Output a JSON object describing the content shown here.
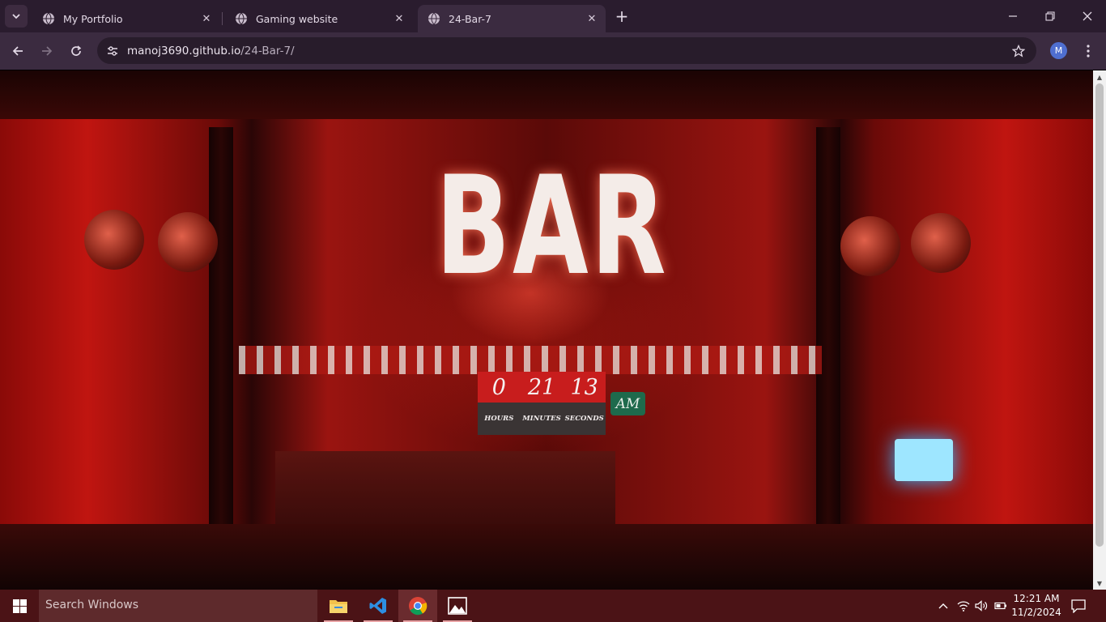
{
  "browser": {
    "tabs": [
      {
        "title": "My Portfolio",
        "active": false
      },
      {
        "title": "Gaming website",
        "active": false
      },
      {
        "title": "24-Bar-7",
        "active": true
      }
    ],
    "url_host": "manoj3690.github.io",
    "url_path": "/24-Bar-7/",
    "profile_initial": "M"
  },
  "page": {
    "sign_text": [
      "B",
      "A",
      "R"
    ],
    "clock": {
      "hours": "0",
      "minutes": "21",
      "seconds": "13",
      "hours_label": "HOURS",
      "minutes_label": "MINUTES",
      "seconds_label": "SECONDS",
      "period": "AM"
    }
  },
  "taskbar": {
    "search_placeholder": "Search Windows",
    "apps": [
      "file-explorer-icon",
      "vscode-icon",
      "chrome-icon",
      "photos-icon"
    ],
    "time": "12:21 AM",
    "date": "11/2/2024"
  },
  "colors": {
    "clock_digits_bg": "#c81d1d",
    "clock_labels_bg": "#3a3434",
    "ampm_bg": "#1e6a4c",
    "browser_chrome": "#3b2b40",
    "taskbar": "#4b1316"
  }
}
